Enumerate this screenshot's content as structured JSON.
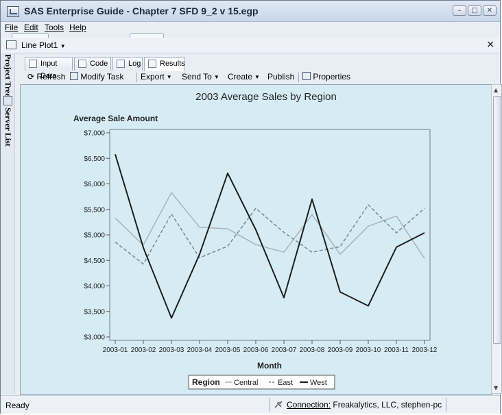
{
  "window": {
    "title": "SAS Enterprise Guide - Chapter 7 SFD 9_2 v 15.egp"
  },
  "menu": {
    "file": "File",
    "edit": "Edit",
    "tools": "Tools",
    "help": "Help"
  },
  "document": {
    "title": "Line Plot1",
    "close": "×"
  },
  "sidebar": {
    "project_tree": "Project Tree",
    "server_list": "Server List"
  },
  "tabs": [
    {
      "label": "Input Data"
    },
    {
      "label": "Code"
    },
    {
      "label": "Log"
    },
    {
      "label": "Results"
    }
  ],
  "toolbar": {
    "refresh": "Refresh",
    "modify_task": "Modify Task",
    "export": "Export",
    "send_to": "Send To",
    "create": "Create",
    "publish": "Publish",
    "properties": "Properties"
  },
  "colors": {
    "background": "#d6ecf4",
    "central": "#a7b2b9",
    "east": "#7c868d",
    "west": "#1d1d1d"
  },
  "chart_data": {
    "type": "line",
    "title": "2003 Average Sales by Region",
    "ylabel": "Average Sale Amount",
    "xlabel": "Month",
    "ylim": [
      3000,
      7000
    ],
    "yticks": [
      "$3,000",
      "$3,500",
      "$4,000",
      "$4,500",
      "$5,000",
      "$5,500",
      "$6,000",
      "$6,500",
      "$7,000"
    ],
    "categories": [
      "2003-01",
      "2003-02",
      "2003-03",
      "2003-04",
      "2003-05",
      "2003-06",
      "2003-07",
      "2003-08",
      "2003-09",
      "2003-10",
      "2003-11",
      "2003-12"
    ],
    "legend_title": "Region",
    "legend_position": "bottom",
    "series": [
      {
        "name": "Central",
        "values": [
          5330,
          4800,
          5830,
          5150,
          5120,
          4810,
          4660,
          5400,
          4620,
          5170,
          5370,
          4540
        ]
      },
      {
        "name": "East",
        "values": [
          4860,
          4430,
          5410,
          4550,
          4780,
          5520,
          5050,
          4660,
          4770,
          5590,
          5040,
          5520
        ]
      },
      {
        "name": "West",
        "values": [
          6580,
          4750,
          3370,
          4620,
          6210,
          5100,
          3770,
          5700,
          3880,
          3610,
          4760,
          5040
        ]
      }
    ]
  },
  "status": {
    "ready": "Ready",
    "connection_label": "Connection:",
    "connection_value": "Freakalytics, LLC, stephen-pc"
  }
}
